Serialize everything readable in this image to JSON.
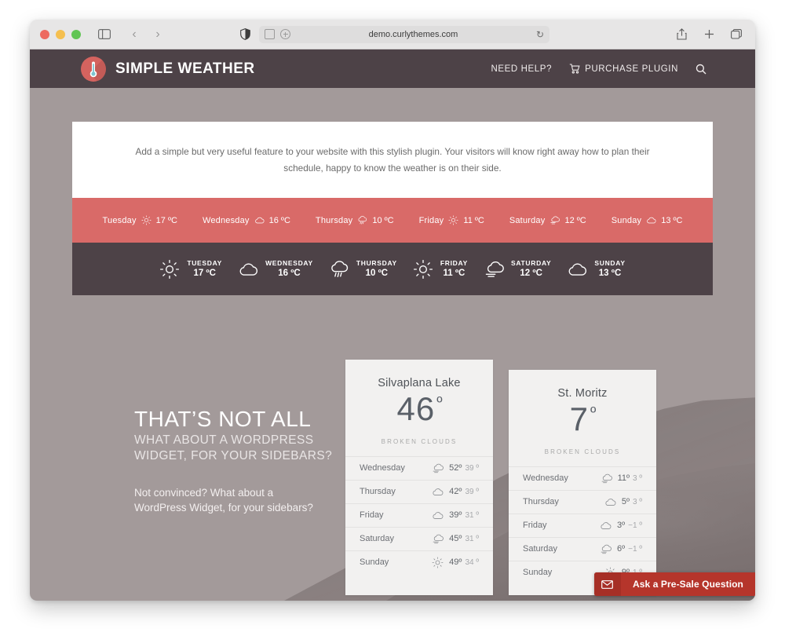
{
  "browser": {
    "url": "demo.curlythemes.com",
    "traffic_lights": [
      "close",
      "minimize",
      "zoom"
    ],
    "icons": {
      "sidebar": "sidebar-toggle-icon",
      "back": "‹",
      "forward": "›",
      "shield": "shield-icon",
      "reader": "reader-view-icon",
      "zoom_control": "page-zoom-icon",
      "reload": "↻",
      "share": "share-icon",
      "new_tab": "+",
      "tabs": "tab-overview-icon"
    }
  },
  "site_header": {
    "brand_first": "SIMPLE",
    "brand_second": "WEATHER",
    "logo_icon": "thermometer-icon",
    "nav": [
      {
        "label": "NEED HELP?",
        "icon": null
      },
      {
        "label": "PURCHASE PLUGIN",
        "icon": "cart-icon"
      }
    ],
    "search_icon": "search-icon"
  },
  "intro": {
    "text": "Add a simple but very useful feature to your website with this stylish plugin. Your visitors will know right away how to plan their schedule, happy to know the weather is on their side."
  },
  "inline_strip": {
    "items": [
      {
        "day": "Tuesday",
        "icon": "sun-icon",
        "temp": "17 ºC"
      },
      {
        "day": "Wednesday",
        "icon": "cloud-icon",
        "temp": "16 ºC"
      },
      {
        "day": "Thursday",
        "icon": "rain-icon",
        "temp": "10 ºC"
      },
      {
        "day": "Friday",
        "icon": "sun-icon",
        "temp": "11 ºC"
      },
      {
        "day": "Saturday",
        "icon": "cloud-wind-icon",
        "temp": "12 ºC"
      },
      {
        "day": "Sunday",
        "icon": "cloud-icon",
        "temp": "13 ºC"
      }
    ]
  },
  "dark_strip": {
    "items": [
      {
        "day": "TUESDAY",
        "icon": "sun-icon",
        "temp": "17 ºC"
      },
      {
        "day": "WEDNESDAY",
        "icon": "cloud-icon",
        "temp": "16 ºC"
      },
      {
        "day": "THURSDAY",
        "icon": "rain-icon",
        "temp": "10 ºC"
      },
      {
        "day": "FRIDAY",
        "icon": "sun-icon",
        "temp": "11 ºC"
      },
      {
        "day": "SATURDAY",
        "icon": "cloud-wind-icon",
        "temp": "12 ºC"
      },
      {
        "day": "SUNDAY",
        "icon": "cloud-icon",
        "temp": "13 ºC"
      }
    ]
  },
  "promo": {
    "headline": "THAT’S NOT ALL",
    "subheadline_line1": "WHAT ABOUT A WORDPRESS",
    "subheadline_line2": "WIDGET, FOR YOUR SIDEBARS?",
    "body_line1": "Not convinced? What about a",
    "body_line2": "WordPress Widget, for your sidebars?"
  },
  "widgets": [
    {
      "city": "Silvaplana Lake",
      "temp": "46",
      "degree": "º",
      "condition": "BROKEN CLOUDS",
      "forecast": [
        {
          "day": "Wednesday",
          "icon": "cloud-wind-icon",
          "high": "52º",
          "low": "39 º"
        },
        {
          "day": "Thursday",
          "icon": "cloud-icon",
          "high": "42º",
          "low": "39 º"
        },
        {
          "day": "Friday",
          "icon": "cloud-icon",
          "high": "39º",
          "low": "31 º"
        },
        {
          "day": "Saturday",
          "icon": "cloud-wind-icon",
          "high": "45º",
          "low": "31 º"
        },
        {
          "day": "Sunday",
          "icon": "sun-icon",
          "high": "49º",
          "low": "34 º"
        }
      ]
    },
    {
      "city": "St. Moritz",
      "temp": "7",
      "degree": "º",
      "condition": "BROKEN CLOUDS",
      "forecast": [
        {
          "day": "Wednesday",
          "icon": "cloud-wind-icon",
          "high": "11º",
          "low": "3 º"
        },
        {
          "day": "Thursday",
          "icon": "cloud-icon",
          "high": "5º",
          "low": "3 º"
        },
        {
          "day": "Friday",
          "icon": "cloud-icon",
          "high": "3º",
          "low": "−1 º"
        },
        {
          "day": "Saturday",
          "icon": "cloud-wind-icon",
          "high": "6º",
          "low": "−1 º"
        },
        {
          "day": "Sunday",
          "icon": "sun-icon",
          "high": "9º",
          "low": "1 º"
        }
      ]
    }
  ],
  "presale": {
    "label": "Ask a Pre-Sale Question",
    "icon": "envelope-icon"
  },
  "colors": {
    "header_dark": "#4d4247",
    "strip_red": "#d96a68",
    "page_bg": "#a39a9a",
    "logo_red": "#d4635f",
    "presale_red": "#b5352b",
    "card_bg": "#f2f1f0"
  }
}
